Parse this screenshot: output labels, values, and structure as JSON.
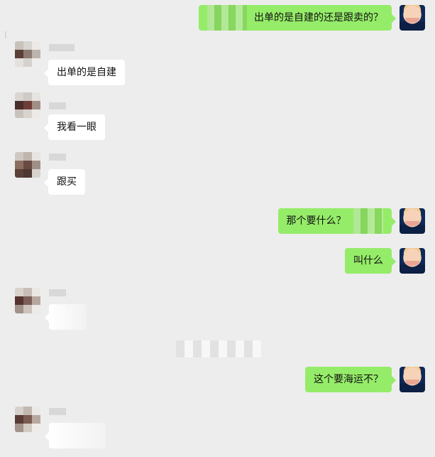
{
  "colors": {
    "background": "#ededed",
    "bubble_in": "#ffffff",
    "bubble_out": "#95ec69"
  },
  "messages": [
    {
      "side": "right",
      "text": "出单的是自建的还是跟卖的？"
    },
    {
      "side": "left",
      "text": "出单的是自建"
    },
    {
      "side": "left",
      "text": "我看一眼"
    },
    {
      "side": "left",
      "text": "跟买"
    },
    {
      "side": "right",
      "text": "那个要什么？"
    },
    {
      "side": "right",
      "text": "叫什么"
    },
    {
      "side": "right",
      "text": "这个要海运不？"
    }
  ],
  "icons": {
    "incoming_avatar": "pixelated-avatar-icon",
    "outgoing_avatar": "user-avatar-icon"
  }
}
